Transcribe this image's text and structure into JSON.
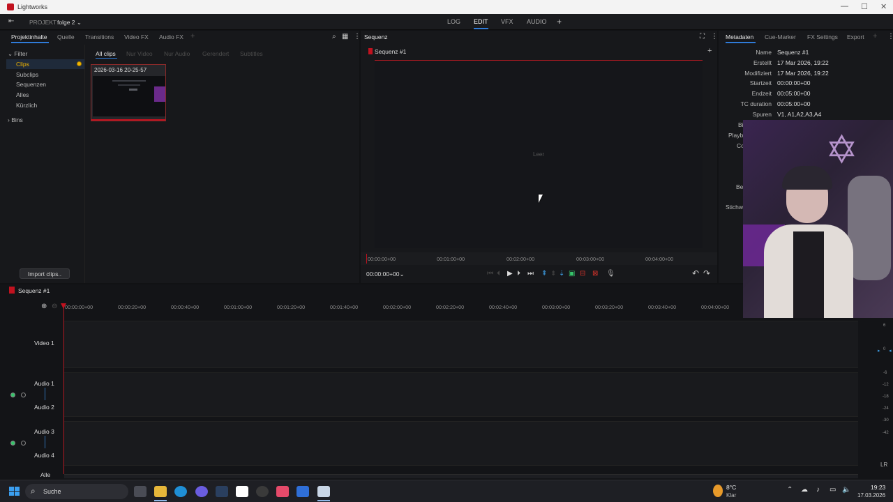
{
  "window": {
    "title": "Lightworks"
  },
  "header": {
    "project_label": "PROJEKT",
    "project_name": "folge 2",
    "modes": [
      "LOG",
      "EDIT",
      "VFX",
      "AUDIO"
    ],
    "active_mode": "EDIT"
  },
  "left_panel": {
    "tabs": [
      "Projektinhalte",
      "Quelle",
      "Transitions",
      "Video FX",
      "Audio FX"
    ],
    "active_tab": "Projektinhalte",
    "filter": {
      "label": "Filter",
      "items": [
        "Clips",
        "Subclips",
        "Sequenzen",
        "Alles",
        "Kürzlich"
      ],
      "active": "Clips"
    },
    "bins_label": "Bins",
    "clip_filters": [
      "All clips",
      "Nur Video",
      "Nur Audio",
      "Gerendert",
      "Subtitles"
    ],
    "clip": {
      "name": "2026-03-16 20-25-57"
    },
    "import_button": "Import clips.."
  },
  "viewer": {
    "panel_title": "Sequenz",
    "sequence_name": "Sequenz #1",
    "empty_text": "Leer",
    "ruler": [
      "00:00:00+00",
      "00:01:00+00",
      "00:02:00+00",
      "00:03:00+00",
      "00:04:00+00"
    ],
    "current_tc": "00:00:00+00"
  },
  "metadata": {
    "tabs": [
      "Metadaten",
      "Cue-Marker",
      "FX Settings",
      "Export"
    ],
    "active_tab": "Metadaten",
    "rows": [
      {
        "k": "Name",
        "v": "Sequenz #1"
      },
      {
        "k": "Erstellt",
        "v": "17 Mar 2026, 19:22"
      },
      {
        "k": "Modifiziert",
        "v": "17 Mar 2026, 19:22"
      },
      {
        "k": "Startzeit",
        "v": "00:00:00+00"
      },
      {
        "k": "Endzeit",
        "v": "00:05:00+00"
      },
      {
        "k": "TC duration",
        "v": "00:05:00+00"
      },
      {
        "k": "Spuren",
        "v": "V1, A1,A2,A3,A4"
      }
    ],
    "cut_labels": [
      "Bi",
      "Playb",
      "Co",
      "Be",
      "Stichw"
    ]
  },
  "timeline": {
    "title": "Sequenz #1",
    "ruler": [
      "00:00:00+00",
      "00:00:20+00",
      "00:00:40+00",
      "00:01:00+00",
      "00:01:20+00",
      "00:01:40+00",
      "00:02:00+00",
      "00:02:20+00",
      "00:02:40+00",
      "00:03:00+00",
      "00:03:20+00",
      "00:03:40+00",
      "00:04:00+00"
    ],
    "tracks": [
      "Video 1",
      "Audio 1",
      "Audio 2",
      "Audio 3",
      "Audio 4"
    ],
    "all_label": "Alle",
    "meter_labels": [
      "6",
      "0",
      "-6",
      "-12",
      "-18",
      "-24",
      "-30",
      "-42"
    ],
    "lr": "LR"
  },
  "taskbar": {
    "search": "Suche",
    "weather_temp": "8°C",
    "weather_text": "Klar",
    "time": "19:23",
    "date": "17.03.2026"
  },
  "colors": {
    "accent": "#2f7bd8",
    "playhead": "#c1121f",
    "clips_active": "#f0b400"
  }
}
